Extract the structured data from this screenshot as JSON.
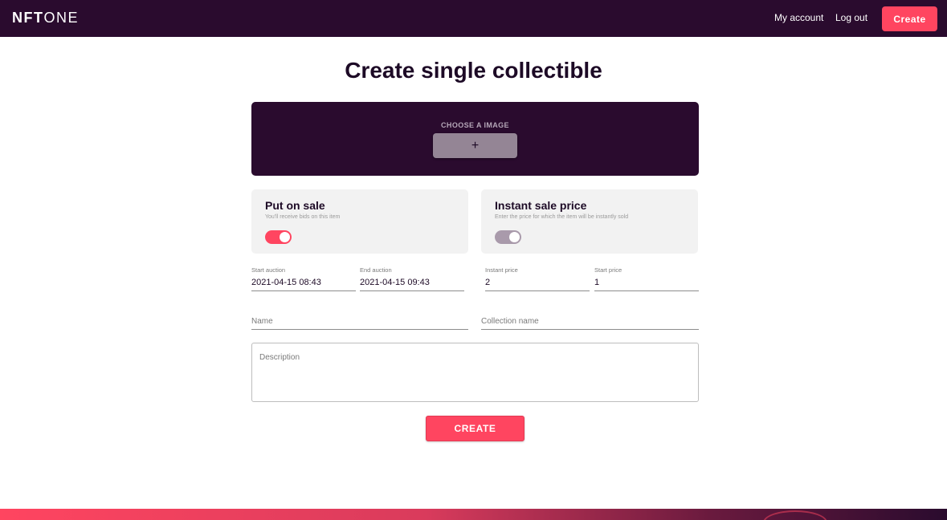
{
  "header": {
    "logo_bold": "NFT",
    "logo_light": "ONE",
    "nav": {
      "my_account": "My account",
      "log_out": "Log out",
      "create": "Create"
    }
  },
  "page": {
    "title": "Create single collectible"
  },
  "upload": {
    "label": "CHOOSE A IMAGE",
    "button_glyph": "+"
  },
  "cards": {
    "put_on_sale": {
      "title": "Put on sale",
      "subtitle": "You'll receive bids on this item",
      "toggle_on": true
    },
    "instant_sale": {
      "title": "Instant sale price",
      "subtitle": "Enter the price for which the item will be instantly sold",
      "toggle_on": false
    }
  },
  "fields": {
    "start_auction": {
      "label": "Start auction",
      "value": "2021-04-15 08:43"
    },
    "end_auction": {
      "label": "End auction",
      "value": "2021-04-15 09:43"
    },
    "instant_price": {
      "label": "Instant price",
      "value": "2"
    },
    "start_price": {
      "label": "Start price",
      "value": "1"
    },
    "name": {
      "placeholder": "Name"
    },
    "collection_name": {
      "placeholder": "Collection name"
    },
    "description": {
      "placeholder": "Description"
    }
  },
  "actions": {
    "create_label": "CREATE"
  },
  "colors": {
    "brand_dark": "#2a0b2e",
    "accent": "#ff4560",
    "card_bg": "#f2f2f2"
  }
}
